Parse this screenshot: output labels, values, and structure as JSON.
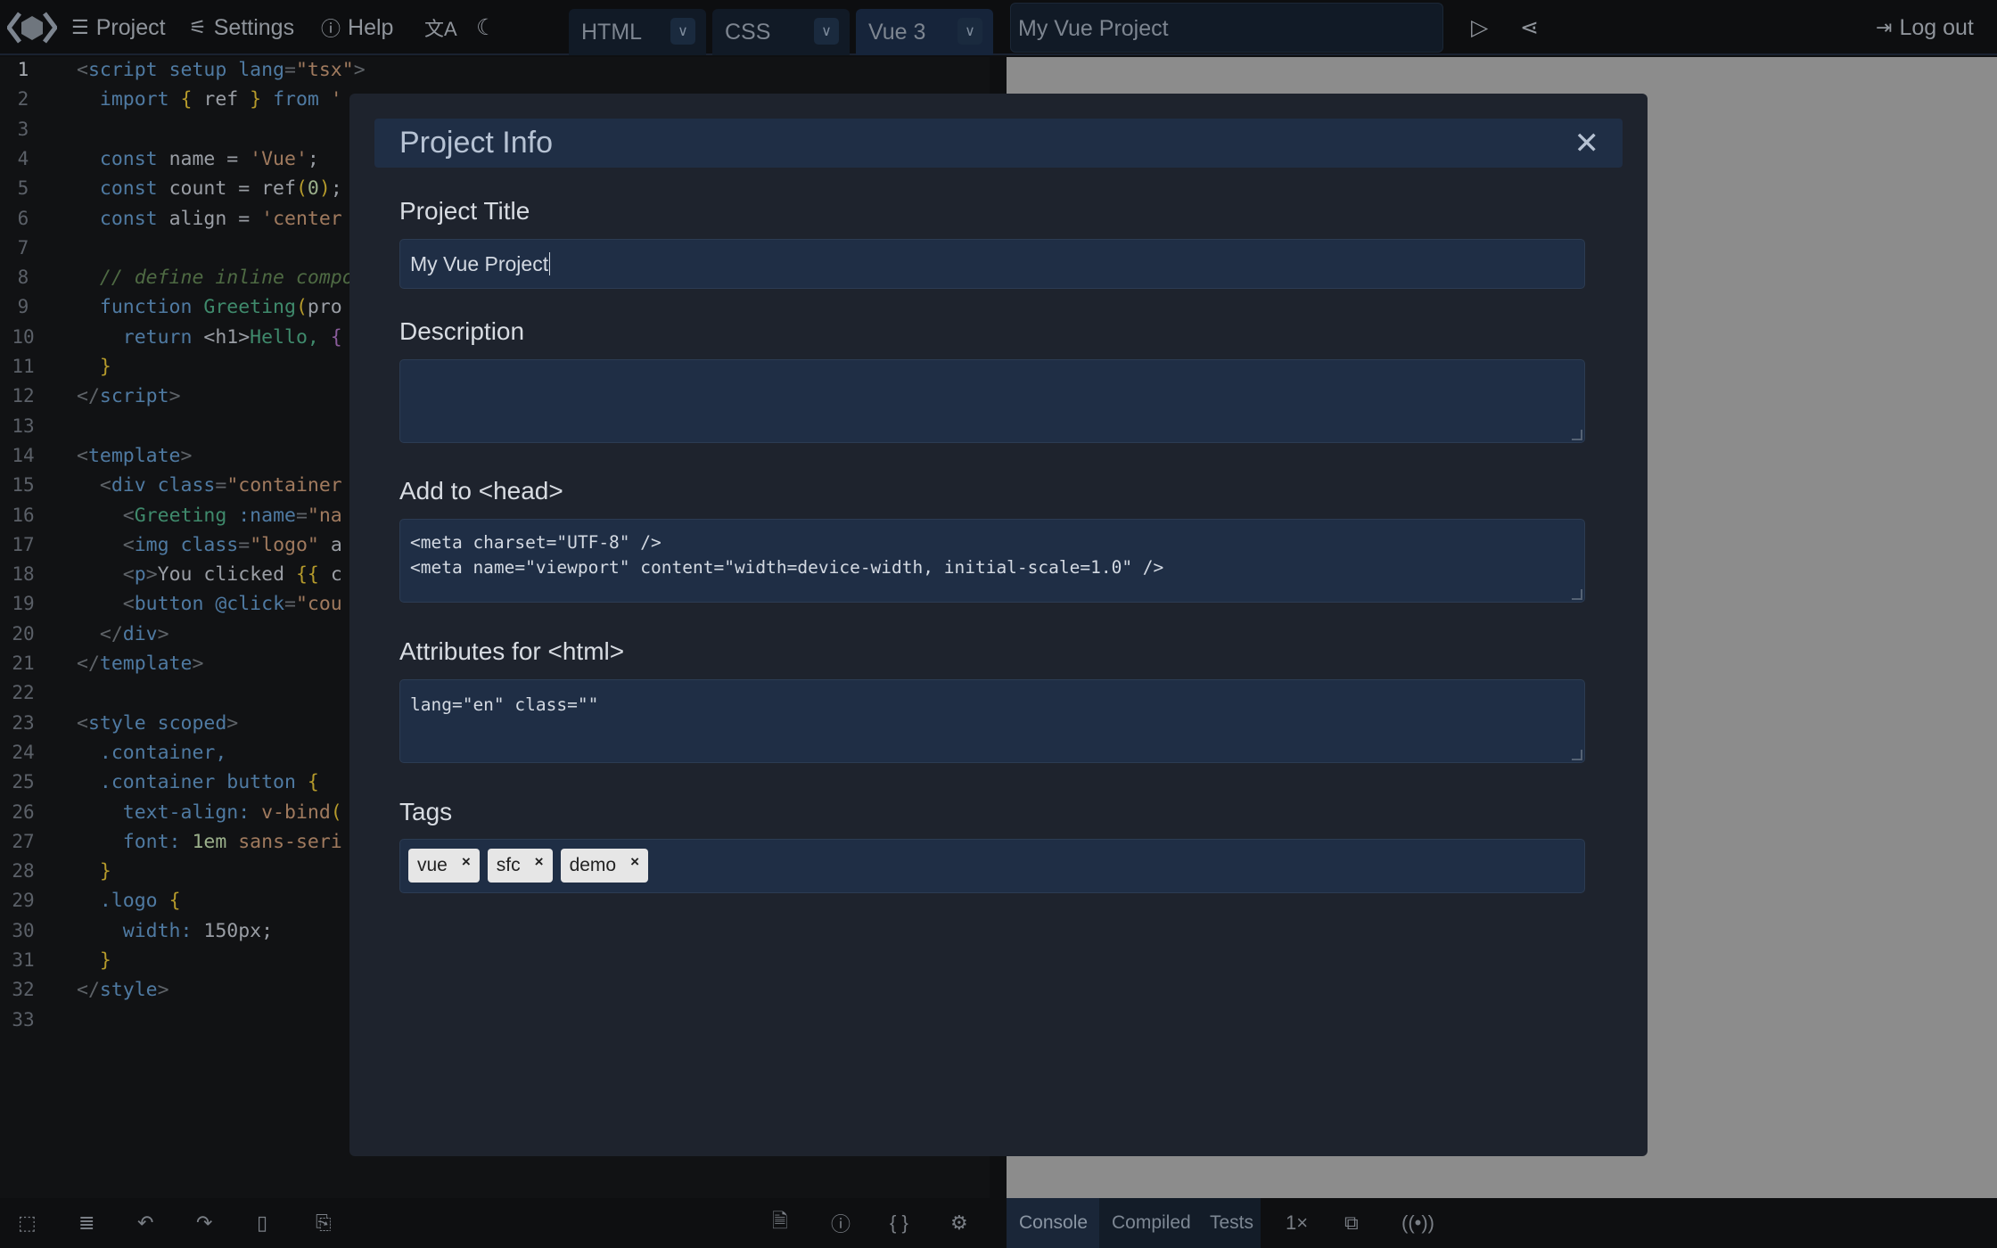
{
  "topbar": {
    "menu": [
      {
        "icon": "menu-icon",
        "glyph": "☰",
        "label": "Project"
      },
      {
        "icon": "sliders-icon",
        "glyph": "⚙",
        "label": "Settings"
      },
      {
        "icon": "help-icon",
        "glyph": "ⓘ",
        "label": "Help"
      }
    ],
    "language_icon": "translate-icon",
    "theme_icon": "moon-icon",
    "selectors": [
      {
        "label": "HTML"
      },
      {
        "label": "CSS"
      },
      {
        "label": "Vue 3"
      }
    ],
    "project_title": "My Vue Project",
    "run_icon": "play-icon",
    "share_icon": "share-icon",
    "logout_label": "Log out"
  },
  "editor": {
    "line_numbers": [
      "1",
      "2",
      "3",
      "4",
      "5",
      "6",
      "7",
      "8",
      "9",
      "10",
      "11",
      "12",
      "13",
      "14",
      "15",
      "16",
      "17",
      "18",
      "19",
      "20",
      "21",
      "22",
      "23",
      "24",
      "25",
      "26",
      "27",
      "28",
      "29",
      "30",
      "31",
      "32",
      "33"
    ],
    "lines": [
      [
        [
          "<",
          "p"
        ],
        [
          "script ",
          "k"
        ],
        [
          "setup lang",
          "k"
        ],
        [
          "=",
          "p"
        ],
        [
          "\"tsx\"",
          "s"
        ],
        [
          ">",
          "p"
        ]
      ],
      [
        [
          "  import ",
          "k"
        ],
        [
          "{ ",
          "b"
        ],
        [
          "ref ",
          ""
        ],
        [
          "} ",
          "b"
        ],
        [
          "from ",
          "k"
        ],
        [
          "'",
          "s"
        ]
      ],
      [],
      [
        [
          "  const ",
          "k"
        ],
        [
          "name = ",
          ""
        ],
        [
          "'Vue'",
          "s"
        ],
        [
          ";",
          ""
        ]
      ],
      [
        [
          "  const ",
          "k"
        ],
        [
          "count = ref",
          ""
        ],
        [
          "(",
          "b"
        ],
        [
          "0",
          "n"
        ],
        [
          ")",
          "b"
        ],
        [
          ";",
          ""
        ]
      ],
      [
        [
          "  const ",
          "k"
        ],
        [
          "align = ",
          ""
        ],
        [
          "'center",
          "s"
        ]
      ],
      [],
      [
        [
          "  // define inline compo",
          "c"
        ]
      ],
      [
        [
          "  function ",
          "k"
        ],
        [
          "Greeting",
          "f"
        ],
        [
          "(",
          "b"
        ],
        [
          "pro",
          ""
        ]
      ],
      [
        [
          "    return ",
          "k"
        ],
        [
          "<h1>",
          ""
        ],
        [
          "Hello, ",
          "f"
        ],
        [
          "{",
          "pu"
        ]
      ],
      [
        [
          "  }",
          "b"
        ]
      ],
      [
        [
          "</",
          "p"
        ],
        [
          "script",
          "k"
        ],
        [
          ">",
          "p"
        ]
      ],
      [],
      [
        [
          "<",
          "p"
        ],
        [
          "template",
          "k"
        ],
        [
          ">",
          "p"
        ]
      ],
      [
        [
          "  <",
          "p"
        ],
        [
          "div ",
          "k"
        ],
        [
          "class",
          "k"
        ],
        [
          "=",
          "p"
        ],
        [
          "\"container",
          "s"
        ]
      ],
      [
        [
          "    <",
          "p"
        ],
        [
          "Greeting ",
          "f"
        ],
        [
          ":name",
          "k"
        ],
        [
          "=",
          "p"
        ],
        [
          "\"na",
          "s"
        ]
      ],
      [
        [
          "    <",
          "p"
        ],
        [
          "img ",
          "k"
        ],
        [
          "class",
          "k"
        ],
        [
          "=",
          "p"
        ],
        [
          "\"logo\" ",
          "s"
        ],
        [
          "a",
          ""
        ]
      ],
      [
        [
          "    <",
          "p"
        ],
        [
          "p",
          "k"
        ],
        [
          ">",
          "p"
        ],
        [
          "You clicked ",
          ""
        ],
        [
          "{{ ",
          "b"
        ],
        [
          "c",
          ""
        ]
      ],
      [
        [
          "    <",
          "p"
        ],
        [
          "button ",
          "k"
        ],
        [
          "@click",
          "k"
        ],
        [
          "=",
          "p"
        ],
        [
          "\"cou",
          "s"
        ]
      ],
      [
        [
          "  </",
          "p"
        ],
        [
          "div",
          "k"
        ],
        [
          ">",
          "p"
        ]
      ],
      [
        [
          "</",
          "p"
        ],
        [
          "template",
          "k"
        ],
        [
          ">",
          "p"
        ]
      ],
      [],
      [
        [
          "<",
          "p"
        ],
        [
          "style ",
          "k"
        ],
        [
          "scoped",
          "k"
        ],
        [
          ">",
          "p"
        ]
      ],
      [
        [
          "  .container,",
          "k"
        ]
      ],
      [
        [
          "  .container button ",
          "k"
        ],
        [
          "{",
          "b"
        ]
      ],
      [
        [
          "    text-align: ",
          "k"
        ],
        [
          "v-bind",
          "s"
        ],
        [
          "(",
          "b"
        ]
      ],
      [
        [
          "    font: ",
          "k"
        ],
        [
          "1em ",
          "n"
        ],
        [
          "sans-seri",
          "s"
        ]
      ],
      [
        [
          "  }",
          "b"
        ]
      ],
      [
        [
          "  .logo ",
          "k"
        ],
        [
          "{",
          "b"
        ]
      ],
      [
        [
          "    width: ",
          "k"
        ],
        [
          "150px",
          ""
        ],
        [
          ";",
          ""
        ]
      ],
      [
        [
          "  }",
          "b"
        ]
      ],
      [
        [
          "</",
          "p"
        ],
        [
          "style",
          "k"
        ],
        [
          ">",
          "p"
        ]
      ],
      []
    ]
  },
  "bottombar": {
    "left_icons": [
      "select-icon",
      "format-icon",
      "undo-icon",
      "redo-icon",
      "clipboard-icon",
      "copy-icon"
    ],
    "right_icons": [
      "file-icon",
      "info-icon",
      "braces-icon",
      "settings-icon"
    ],
    "tabs": [
      {
        "label": "Console",
        "active": true
      },
      {
        "label": "Compiled"
      },
      {
        "label": "Tests"
      }
    ],
    "zoom_label": "1×",
    "extra_icons": [
      "open-external-icon",
      "broadcast-icon"
    ]
  },
  "modal": {
    "title": "Project Info",
    "close_icon": "close-icon",
    "fields": {
      "title_label": "Project Title",
      "title_value": "My Vue Project",
      "description_label": "Description",
      "description_value": "",
      "head_label": "Add to <head>",
      "head_value": "<meta charset=\"UTF-8\" />\n<meta name=\"viewport\" content=\"width=device-width, initial-scale=1.0\" />",
      "html_attrs_label": "Attributes for <html>",
      "html_attrs_value": "lang=\"en\" class=\"\"",
      "tags_label": "Tags",
      "tags": [
        {
          "label": "vue",
          "remove": "×"
        },
        {
          "label": "sfc",
          "remove": "×"
        },
        {
          "label": "demo",
          "remove": "×"
        }
      ]
    }
  }
}
